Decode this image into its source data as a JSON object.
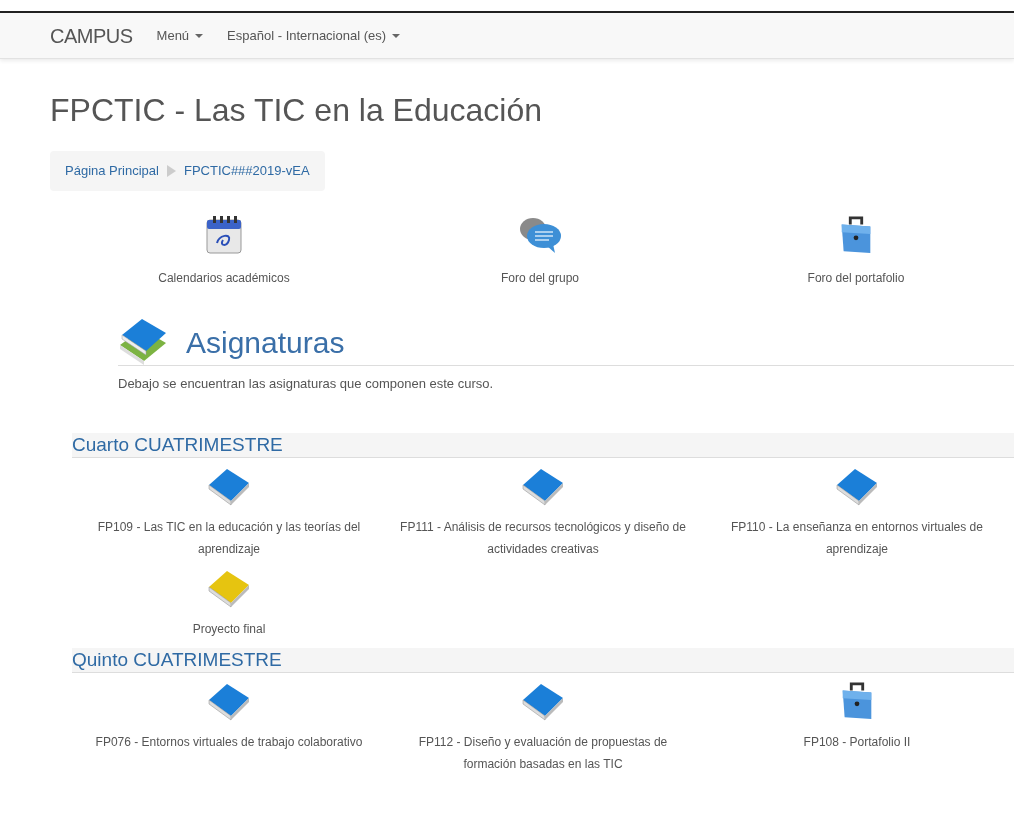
{
  "navbar": {
    "brand": "CAMPUS",
    "menus": [
      {
        "label": "Menú"
      },
      {
        "label": "Español - Internacional (es)"
      }
    ]
  },
  "page_title": "FPCTIC - Las TIC en la Educación",
  "breadcrumb": [
    {
      "label": "Página Principal"
    },
    {
      "label": "FPCTIC###2019-vEA"
    }
  ],
  "shortcuts": [
    {
      "kind": "calendar",
      "label": "Calendarios académicos"
    },
    {
      "kind": "chat",
      "label": "Foro del grupo"
    },
    {
      "kind": "briefcase",
      "label": "Foro del portafolio"
    }
  ],
  "subjects_heading": {
    "title": "Asignaturas",
    "description": "Debajo se encuentran las asignaturas que componen este curso."
  },
  "sections": [
    {
      "title": "Cuarto CUATRIMESTRE",
      "courses": [
        {
          "kind": "book",
          "color": "#1b7fd8",
          "label": "FP109 - Las TIC en la educación y las teorías del aprendizaje"
        },
        {
          "kind": "book",
          "color": "#1b7fd8",
          "label": "FP111 - Análisis de recursos tecnológicos y diseño de actividades creativas"
        },
        {
          "kind": "book",
          "color": "#1b7fd8",
          "label": "FP110 - La enseñanza en entornos virtuales de aprendizaje"
        },
        {
          "kind": "book",
          "color": "#e6c410",
          "label": "Proyecto final"
        }
      ]
    },
    {
      "title": "Quinto CUATRIMESTRE",
      "courses": [
        {
          "kind": "book",
          "color": "#1b7fd8",
          "label": "FP076 - Entornos virtuales de trabajo colaborativo"
        },
        {
          "kind": "book",
          "color": "#1b7fd8",
          "label": "FP112 - Diseño y evaluación de propuestas de formación basadas en las TIC"
        },
        {
          "kind": "briefcase",
          "label": "FP108 - Portafolio II"
        }
      ]
    }
  ]
}
